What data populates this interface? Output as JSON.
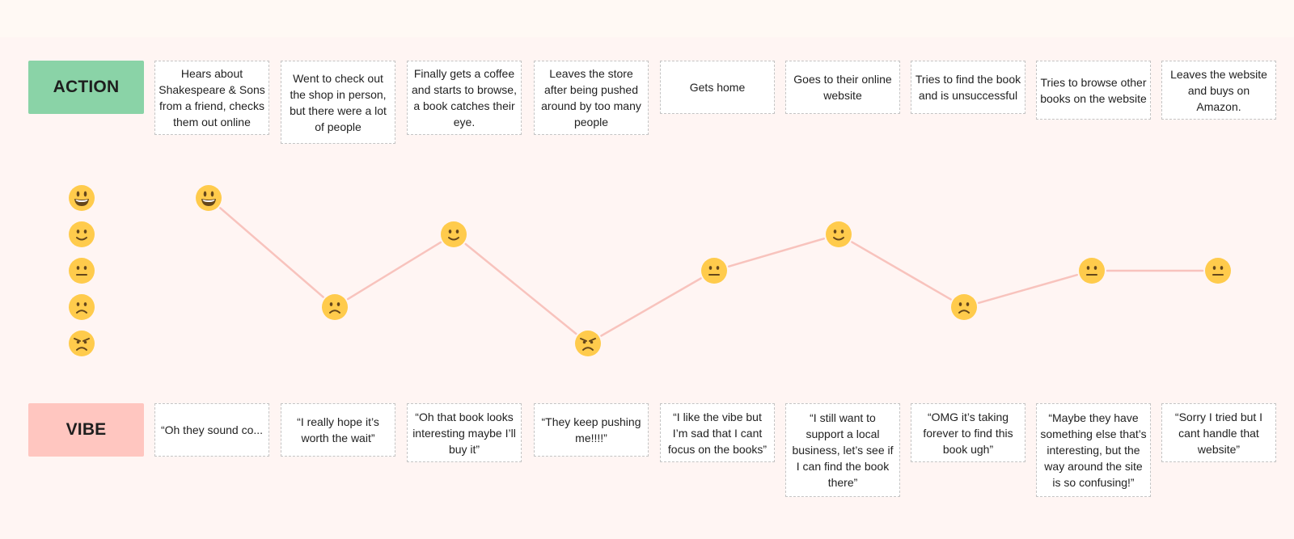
{
  "labels": {
    "action": "ACTION",
    "vibe": "VIBE"
  },
  "colors": {
    "action_label_bg": "#8ad3a7",
    "vibe_label_bg": "#ffc6c0",
    "line": "#f8c3bd",
    "emoji_face": "#ffcb4c",
    "emoji_feature": "#65471b",
    "background": "#fff5f3"
  },
  "scale": {
    "levels": [
      {
        "value": 5,
        "icon": "grinning-face-icon"
      },
      {
        "value": 4,
        "icon": "slightly-smiling-face-icon"
      },
      {
        "value": 3,
        "icon": "neutral-face-icon"
      },
      {
        "value": 2,
        "icon": "slightly-frowning-face-icon"
      },
      {
        "value": 1,
        "icon": "angry-face-icon"
      }
    ]
  },
  "steps": [
    {
      "action": "Hears about Shakespeare & Sons from a friend, checks them out online",
      "vibe_quote": "“Oh they sound co...",
      "mood": 5
    },
    {
      "action": "Went to check out the shop in person, but there were a lot of people",
      "vibe_quote": "“I really hope it’s worth the wait”",
      "mood": 2
    },
    {
      "action": "Finally gets a coffee and starts to browse, a book catches their eye.",
      "vibe_quote": "“Oh that book looks interesting maybe I’ll buy it”",
      "mood": 4
    },
    {
      "action": "Leaves the store after being pushed around by too many people",
      "vibe_quote": "“They keep pushing me!!!!”",
      "mood": 1
    },
    {
      "action": "Gets home",
      "vibe_quote": "“I like the vibe but I’m sad that I cant focus on the books”",
      "mood": 3
    },
    {
      "action": "Goes to their online website",
      "vibe_quote": "“I still want to support a local business, let’s see if I can find the book there”",
      "mood": 4
    },
    {
      "action": "Tries to find the book and is unsuccessful",
      "vibe_quote": "“OMG it’s taking forever to find this book ugh”",
      "mood": 2
    },
    {
      "action": "Tries to browse other books on the website",
      "vibe_quote": "“Maybe they have something else that’s interesting, but the way around the site is so confusing!”",
      "mood": 3
    },
    {
      "action": "Leaves the website and buys on Amazon.",
      "vibe_quote": "“Sorry I tried but I cant handle that website”",
      "mood": 3
    }
  ]
}
